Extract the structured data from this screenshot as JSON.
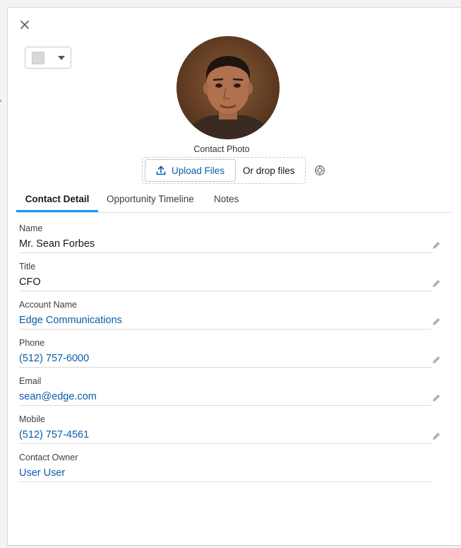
{
  "stray_glyph": "°",
  "panel": {
    "close_icon": "close-icon",
    "color_picker": {
      "swatch_color": "#d8d8d8",
      "caret_icon": "caret-down-icon"
    },
    "photo": {
      "label": "Contact Photo"
    },
    "upload": {
      "button_label": "Upload Files",
      "drop_text": "Or drop files",
      "upload_icon": "upload-icon",
      "aperture_icon": "aperture-icon"
    }
  },
  "tabs": [
    {
      "label": "Contact Detail",
      "active": true
    },
    {
      "label": "Opportunity Timeline",
      "active": false
    },
    {
      "label": "Notes",
      "active": false
    }
  ],
  "fields": [
    {
      "label": "Name",
      "value": "Mr. Sean Forbes",
      "link": false,
      "editable": true
    },
    {
      "label": "Title",
      "value": "CFO",
      "link": false,
      "editable": true
    },
    {
      "label": "Account Name",
      "value": "Edge Communications",
      "link": true,
      "editable": true
    },
    {
      "label": "Phone",
      "value": "(512) 757-6000",
      "link": true,
      "editable": true
    },
    {
      "label": "Email",
      "value": "sean@edge.com",
      "link": true,
      "editable": true
    },
    {
      "label": "Mobile",
      "value": "(512) 757-4561",
      "link": true,
      "editable": true
    },
    {
      "label": "Contact Owner",
      "value": "User User",
      "link": true,
      "editable": false
    }
  ],
  "colors": {
    "link": "#0b5cab",
    "active_tab": "#1b96ff",
    "border": "#dddbda"
  }
}
